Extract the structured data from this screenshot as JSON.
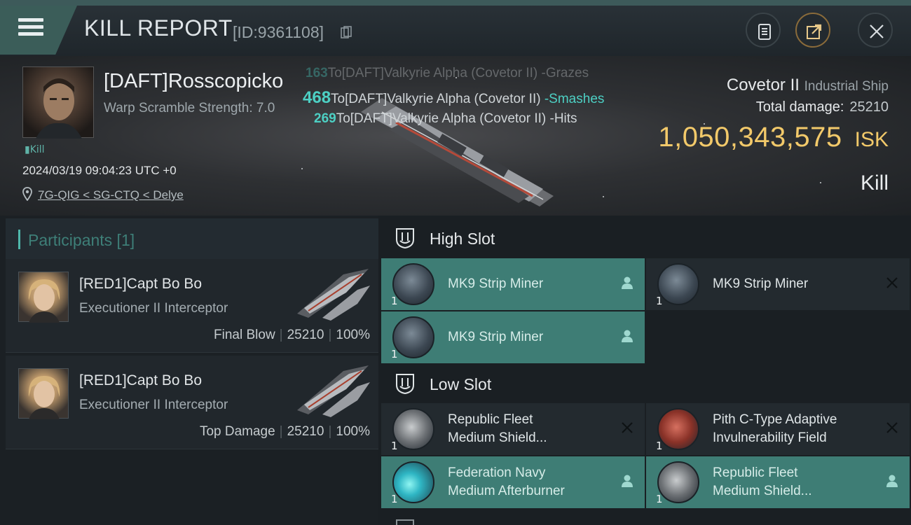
{
  "header": {
    "title": "KILL REPORT",
    "report_id": "[ID:9361108]"
  },
  "victim": {
    "name": "[DAFT]Rosscopicko",
    "warp_scramble": "Warp Scramble Strength: 7.0",
    "badge": "Kill",
    "time": "2024/03/19 09:04:23 UTC +0",
    "location": "7G-QIG < SG-CTQ < Delye"
  },
  "damage_feed": [
    {
      "amount": "163",
      "text": "To[DAFT]Valkyrie Alpha (Covetor II) -Grazes"
    },
    {
      "amount": "468",
      "text": "To[DAFT]Valkyrie Alpha (Covetor II) ",
      "verb": "-Smashes"
    },
    {
      "amount": "269",
      "text": "To[DAFT]Valkyrie Alpha (Covetor II) -Hits"
    }
  ],
  "ship": {
    "name": "Covetor II",
    "class": "Industrial Ship",
    "total_damage_label": "Total damage:",
    "total_damage": "25210",
    "isk_value": "1,050,343,575",
    "isk_unit": "ISK",
    "outcome": "Kill"
  },
  "participants": {
    "title": "Participants [1]",
    "items": [
      {
        "name": "[RED1]Capt Bo Bo",
        "ship": "Executioner II Interceptor",
        "role": "Final Blow",
        "damage": "25210",
        "percent": "100%"
      },
      {
        "name": "[RED1]Capt Bo Bo",
        "ship": "Executioner II Interceptor",
        "role": "Top Damage",
        "damage": "25210",
        "percent": "100%"
      }
    ]
  },
  "slots": {
    "high": {
      "title": "High Slot",
      "modules": [
        {
          "name": "MK9 Strip Miner",
          "qty": "1",
          "status": "fitted"
        },
        {
          "name": "MK9 Strip Miner",
          "qty": "1",
          "status": "destroyed"
        },
        {
          "name": "MK9 Strip Miner",
          "qty": "1",
          "status": "fitted"
        }
      ]
    },
    "low": {
      "title": "Low Slot",
      "modules": [
        {
          "name_line1": "Republic Fleet",
          "name_line2": "Medium Shield...",
          "qty": "1",
          "status": "destroyed"
        },
        {
          "name_line1": "Pith C-Type Adaptive",
          "name_line2": "Invulnerability Field",
          "qty": "1",
          "status": "destroyed"
        },
        {
          "name_line1": "Federation Navy",
          "name_line2": "Medium Afterburner",
          "qty": "1",
          "status": "fitted"
        },
        {
          "name_line1": "Republic Fleet",
          "name_line2": "Medium Shield...",
          "qty": "1",
          "status": "fitted"
        }
      ]
    }
  },
  "colors": {
    "accent_teal": "#4dd0c4",
    "fitted_bg": "#3e7d75",
    "isk_gold": "#f2c96a"
  },
  "icons": [
    "menu-icon",
    "copy-icon",
    "clipboard-icon",
    "share-icon",
    "close-icon",
    "location-pin-icon",
    "slot-shield-icon",
    "pilot-icon",
    "destroyed-x-icon"
  ]
}
